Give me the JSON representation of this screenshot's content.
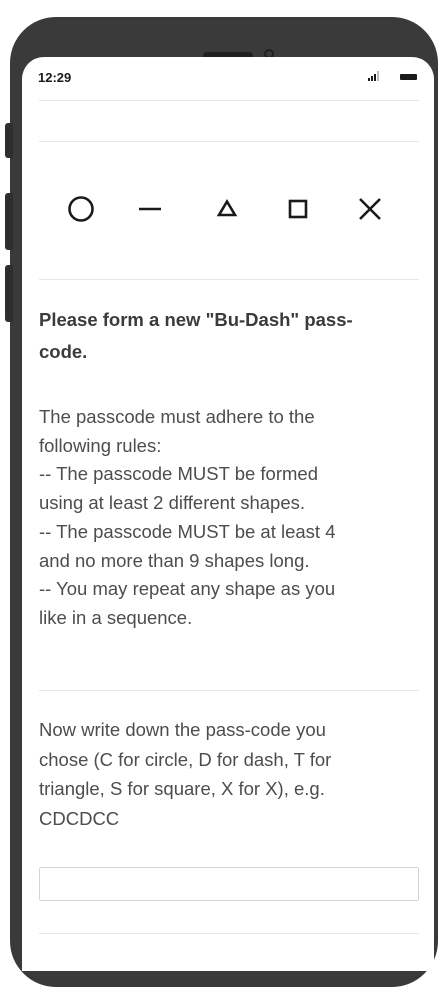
{
  "status_bar": {
    "time": "12:29",
    "signal_icon": "signal-bars-icon",
    "battery_icon": "battery-icon"
  },
  "shapes": [
    {
      "name": "circle",
      "icon": "circle-icon"
    },
    {
      "name": "dash",
      "icon": "dash-icon"
    },
    {
      "name": "triangle",
      "icon": "triangle-icon"
    },
    {
      "name": "square",
      "icon": "square-icon"
    },
    {
      "name": "x",
      "icon": "x-icon"
    }
  ],
  "prompt": {
    "lines": [
      "Please form a new \"Bu-Dash\" pass-",
      "code."
    ]
  },
  "rules": {
    "lines": [
      "The passcode must adhere to the",
      "following rules:",
      "-- The passcode MUST be formed",
      "using at least 2 different shapes.",
      "-- The passcode MUST be at least 4",
      "and no more than 9 shapes long.",
      "-- You may repeat any shape as you",
      "like in a sequence."
    ]
  },
  "question": {
    "lines": [
      "Now write down the pass-code you",
      "chose (C for circle, D for dash, T for",
      "triangle, S for square, X for X), e.g.",
      "CDCDCC"
    ]
  },
  "answer": {
    "value": "",
    "placeholder": ""
  },
  "colors": {
    "device_frame": "#3a3a3a",
    "text_primary": "#3b3b3b",
    "text_body": "#4d4d4d",
    "divider": "#e6e6e6",
    "input_border": "#d4d4d4"
  }
}
